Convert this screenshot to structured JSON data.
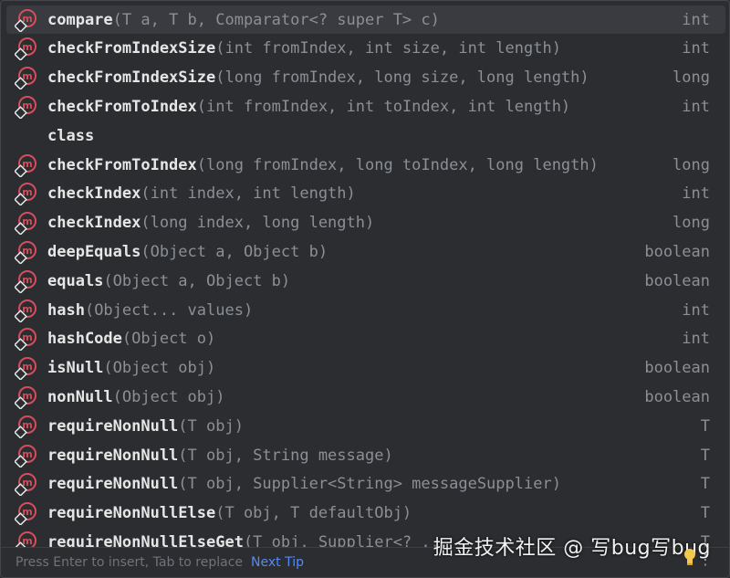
{
  "colors": {
    "background": "#2b2d30",
    "selected_row": "#393b40",
    "name": "#e6e6e6",
    "params": "#8b8f96",
    "icon_red": "#d64d5b",
    "link": "#548af7"
  },
  "icon": "method-icon",
  "items": [
    {
      "name": "compare",
      "params": "(T a, T b, Comparator<? super T> c)",
      "type": "int",
      "icon": true,
      "selected": true
    },
    {
      "name": "checkFromIndexSize",
      "params": "(int fromIndex, int size, int length)",
      "type": "int",
      "icon": true
    },
    {
      "name": "checkFromIndexSize",
      "params": "(long fromIndex, long size, long length)",
      "type": "long",
      "icon": true
    },
    {
      "name": "checkFromToIndex",
      "params": "(int fromIndex, int toIndex, int length)",
      "type": "int",
      "icon": true
    },
    {
      "name": "class",
      "params": "",
      "type": "",
      "icon": false
    },
    {
      "name": "checkFromToIndex",
      "params": "(long fromIndex, long toIndex, long length)",
      "type": "long",
      "icon": true
    },
    {
      "name": "checkIndex",
      "params": "(int index, int length)",
      "type": "int",
      "icon": true
    },
    {
      "name": "checkIndex",
      "params": "(long index, long length)",
      "type": "long",
      "icon": true
    },
    {
      "name": "deepEquals",
      "params": "(Object a, Object b)",
      "type": "boolean",
      "icon": true
    },
    {
      "name": "equals",
      "params": "(Object a, Object b)",
      "type": "boolean",
      "icon": true
    },
    {
      "name": "hash",
      "params": "(Object... values)",
      "type": "int",
      "icon": true
    },
    {
      "name": "hashCode",
      "params": "(Object o)",
      "type": "int",
      "icon": true
    },
    {
      "name": "isNull",
      "params": "(Object obj)",
      "type": "boolean",
      "icon": true
    },
    {
      "name": "nonNull",
      "params": "(Object obj)",
      "type": "boolean",
      "icon": true
    },
    {
      "name": "requireNonNull",
      "params": "(T obj)",
      "type": "T",
      "icon": true
    },
    {
      "name": "requireNonNull",
      "params": "(T obj, String message)",
      "type": "T",
      "icon": true
    },
    {
      "name": "requireNonNull",
      "params": "(T obj, Supplier<String> messageSupplier)",
      "type": "T",
      "icon": true
    },
    {
      "name": "requireNonNullElse",
      "params": "(T obj, T defaultObj)",
      "type": "T",
      "icon": true
    },
    {
      "name": "requireNonNullElseGet",
      "params": "(T obj, Supplier<? ...",
      "type": "T",
      "icon": true
    }
  ],
  "footer": {
    "hint": "Press Enter to insert, Tab to replace",
    "next_tip": "Next Tip",
    "more": "⋮"
  },
  "watermark": "掘金技术社区 @ 写bug写bug"
}
